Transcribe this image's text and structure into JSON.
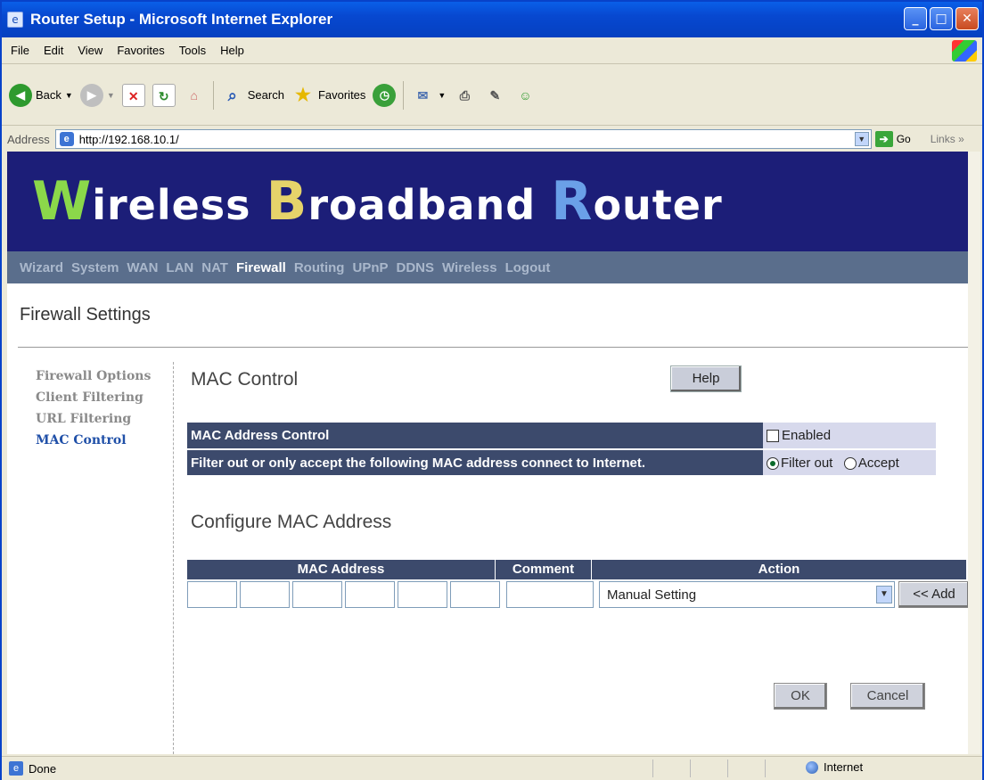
{
  "window": {
    "title": "Router Setup - Microsoft Internet Explorer"
  },
  "menu": [
    "File",
    "Edit",
    "View",
    "Favorites",
    "Tools",
    "Help"
  ],
  "toolbar": {
    "back": "Back",
    "search": "Search",
    "favorites": "Favorites"
  },
  "address": {
    "label": "Address",
    "url": "http://192.168.10.1/",
    "go": "Go",
    "links": "Links"
  },
  "banner": {
    "w": "W",
    "w_rest": "ireless ",
    "b": "B",
    "b_rest": "roadband ",
    "r": "R",
    "r_rest": "outer"
  },
  "nav": [
    "Wizard",
    "System",
    "WAN",
    "LAN",
    "NAT",
    "Firewall",
    "Routing",
    "UPnP",
    "DDNS",
    "Wireless",
    "Logout"
  ],
  "nav_active": "Firewall",
  "page": {
    "heading": "Firewall Settings"
  },
  "sidenav": [
    "Firewall Options",
    "Client Filtering",
    "URL Filtering",
    "MAC Control"
  ],
  "sidenav_selected": "MAC Control",
  "mac_control": {
    "title": "MAC Control",
    "help": "Help",
    "row1_label": "MAC Address Control",
    "row1_value": "Enabled",
    "row1_checked": false,
    "row2_label": "Filter out or only accept  the following MAC address  connect to Internet.",
    "opt_filter": "Filter out",
    "opt_accept": "Accept",
    "selected": "Filter out"
  },
  "configure": {
    "title": "Configure MAC Address",
    "col_mac": "MAC Address",
    "col_comment": "Comment",
    "col_action": "Action",
    "action_value": "Manual Setting",
    "add": "<< Add"
  },
  "buttons": {
    "ok": "OK",
    "cancel": "Cancel"
  },
  "status": {
    "left": "Done",
    "zone": "Internet"
  }
}
